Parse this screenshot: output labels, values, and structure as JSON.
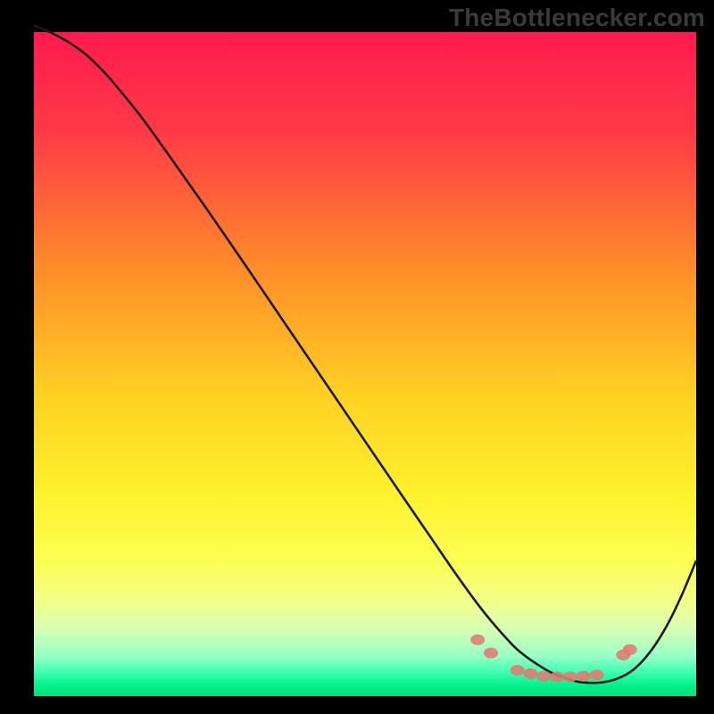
{
  "watermark": {
    "text": "TheBottlenecker.com"
  },
  "colors": {
    "black": "#000000",
    "stroke": "#1a1a1a",
    "marker": "#e37a71",
    "watermark": "#3a3a3a"
  },
  "chart_data": {
    "type": "line",
    "title": "",
    "xlabel": "",
    "ylabel": "",
    "xlim": [
      0,
      100
    ],
    "ylim": [
      0,
      100
    ],
    "gradient_stops": [
      {
        "offset": 0.0,
        "color": "#ff1a4e"
      },
      {
        "offset": 0.15,
        "color": "#ff3a47"
      },
      {
        "offset": 0.35,
        "color": "#ff8a2a"
      },
      {
        "offset": 0.55,
        "color": "#ffd223"
      },
      {
        "offset": 0.7,
        "color": "#fff22e"
      },
      {
        "offset": 0.8,
        "color": "#fbff55"
      },
      {
        "offset": 0.86,
        "color": "#f2ff8c"
      },
      {
        "offset": 0.9,
        "color": "#d6ffb5"
      },
      {
        "offset": 0.94,
        "color": "#96ffc5"
      },
      {
        "offset": 0.965,
        "color": "#3affaf"
      },
      {
        "offset": 0.985,
        "color": "#00f08a"
      },
      {
        "offset": 1.0,
        "color": "#00e07a"
      }
    ],
    "series": [
      {
        "name": "curve",
        "x": [
          0,
          2,
          4,
          6,
          8,
          10,
          12,
          16,
          20,
          26,
          32,
          38,
          44,
          50,
          56,
          60,
          64,
          68,
          72,
          74,
          76,
          78,
          80,
          82,
          84,
          86,
          88,
          90,
          92,
          94,
          96,
          98,
          100
        ],
        "y": [
          101,
          100.2,
          99.2,
          98.0,
          96.5,
          94.6,
          92.4,
          87.5,
          82.0,
          73.5,
          64.8,
          56.0,
          47.2,
          38.4,
          29.6,
          23.8,
          18.0,
          12.6,
          8.0,
          6.2,
          4.8,
          3.6,
          2.8,
          2.2,
          2.0,
          2.1,
          2.6,
          3.6,
          5.4,
          8.0,
          11.4,
          15.6,
          20.4
        ]
      }
    ],
    "markers": [
      {
        "x": 67,
        "y": 8.5
      },
      {
        "x": 69,
        "y": 6.5
      },
      {
        "x": 73,
        "y": 3.9
      },
      {
        "x": 75,
        "y": 3.4
      },
      {
        "x": 77,
        "y": 3.0
      },
      {
        "x": 79,
        "y": 2.9
      },
      {
        "x": 81,
        "y": 2.9
      },
      {
        "x": 83,
        "y": 3.0
      },
      {
        "x": 85,
        "y": 3.2
      },
      {
        "x": 89,
        "y": 6.2
      },
      {
        "x": 90,
        "y": 7.0
      }
    ]
  }
}
